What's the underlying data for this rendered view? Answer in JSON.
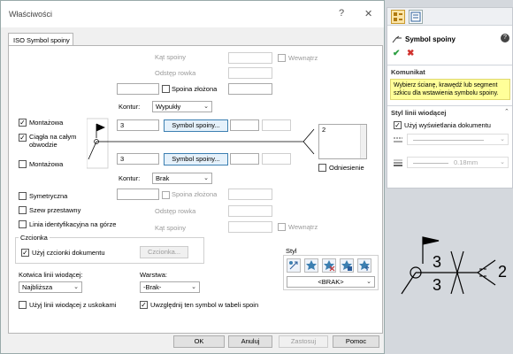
{
  "dialog": {
    "title": "Właściwości",
    "help_label": "?",
    "close_label": "✕",
    "tab": "ISO Symbol spoiny",
    "upper": {
      "field_symbol": "Kąt spoiny",
      "field_gap": "Odstęp rowka",
      "inner_label": "Wewnątrz",
      "compound_label": "Spoina złożona",
      "contour_label": "Kontur:",
      "contour_value": "Wypukły",
      "value1": "3",
      "symbol_button": "Symbol spoiny..."
    },
    "left_checks": {
      "field_weld": "Montażowa",
      "all_around": "Ciągła na całym obwodzie",
      "field_weld_lower": "Montażowa"
    },
    "lower": {
      "value1": "3",
      "symbol_button": "Symbol spoiny...",
      "contour_label": "Kontur:",
      "contour_value": "Brak",
      "compound_label": "Spoina złożona",
      "field_gap": "Odstęp rowka",
      "field_angle": "Kąt spoiny",
      "inner_label": "Wewnątrz"
    },
    "tail_value": "2",
    "reference_label": "Odniesienie",
    "symmetric_label": "Symetryczna",
    "staggered_label": "Szew przestawny",
    "id_line_label": "Linia identyfikacyjna na górze",
    "font": {
      "group": "Czcionka",
      "use_doc_font": "Użyj czcionki dokumentu",
      "font_button": "Czcionka..."
    },
    "style": {
      "group": "Styl",
      "value": "<BRAK>"
    },
    "leader_anchor": {
      "label": "Kotwica linii wiodącej:",
      "value": "Najbliższa"
    },
    "layer": {
      "label": "Warstwa:",
      "value": "-Brak-"
    },
    "bent_leader": "Użyj linii wiodącej z uskokami",
    "include_bom": "Uwzględnij ten symbol w tabeli spoin",
    "buttons": {
      "ok": "OK",
      "cancel": "Anuluj",
      "apply": "Zastosuj",
      "help": "Pomoc"
    }
  },
  "property_manager": {
    "title": "Symbol spoiny",
    "message_header": "Komunikat",
    "message": "Wybierz ścianę, krawędź lub segment szkicu dla wstawienia symbolu spoiny.",
    "leader_style_header": "Styl linii wiodącej",
    "use_doc_display": "Użyj wyświetlania dokumentu",
    "thickness": "0.18mm"
  },
  "preview": {
    "upper_value": "3",
    "lower_value": "3",
    "tail_value": "2"
  },
  "colors": {
    "message_bg": "#ffff99",
    "accept": "#2ea043",
    "cancel": "#d0312d"
  }
}
